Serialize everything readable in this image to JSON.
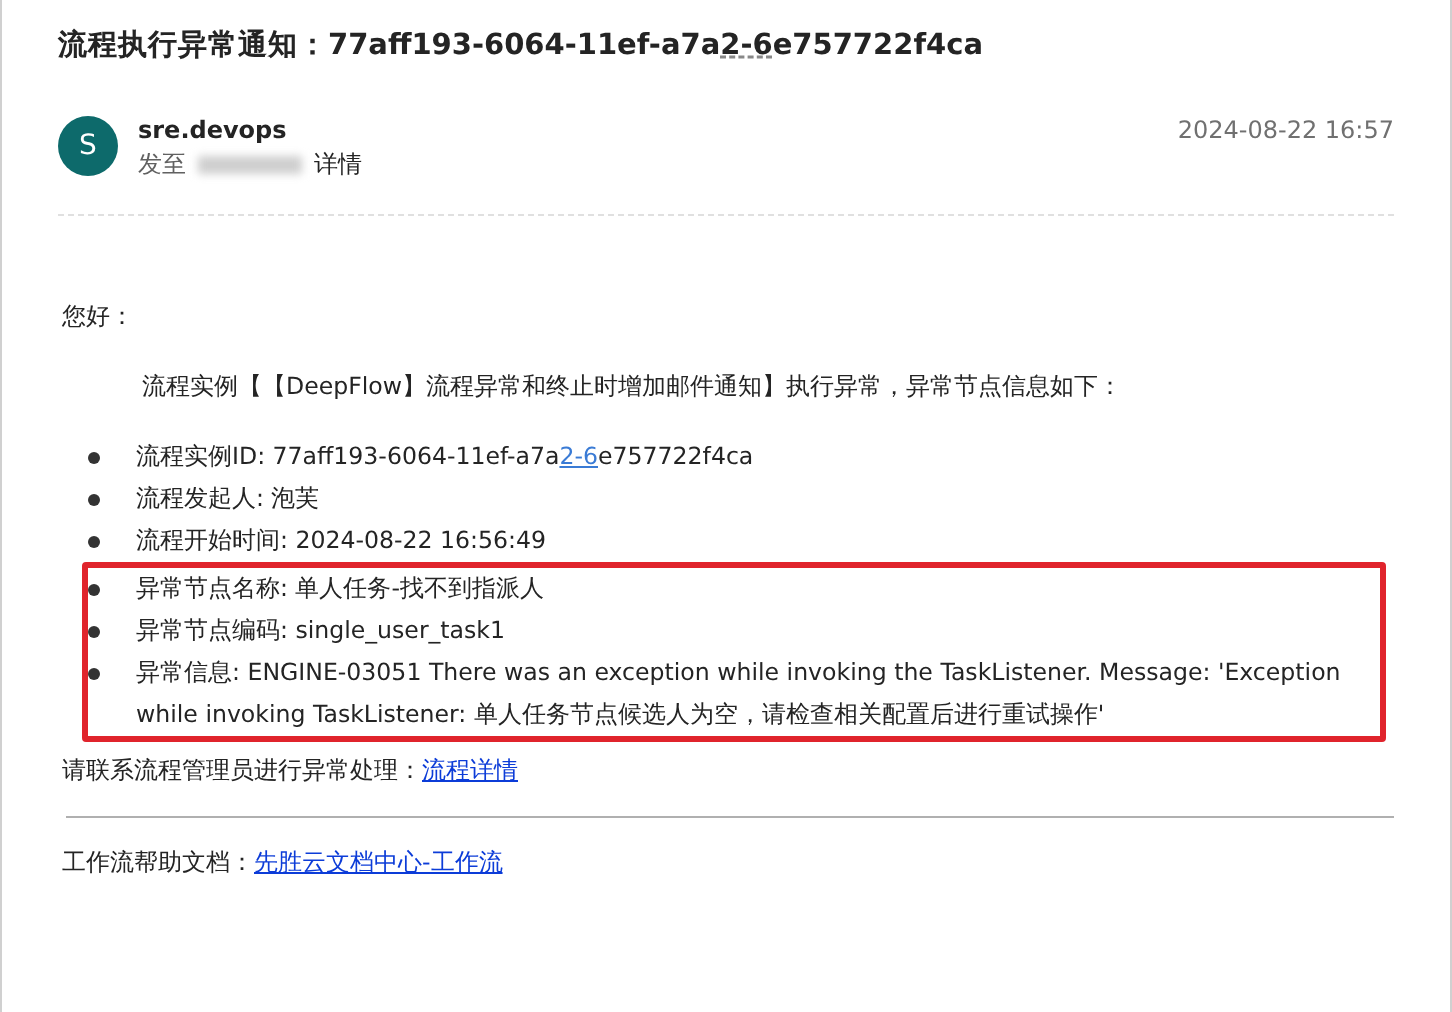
{
  "email": {
    "subject_parts": [
      {
        "text": "流程执行异常通知：77aff193-6064-11ef-a7a",
        "link": false
      },
      {
        "text": "2-6",
        "link": true
      },
      {
        "text": "e757722f4ca",
        "link": false
      }
    ],
    "sender": {
      "avatar_letter": "S",
      "name": "sre.devops",
      "to_label": "发至",
      "details_link": "详情",
      "date": "2024-08-22 16:57"
    },
    "greeting": "您好：",
    "intro": "流程实例【【DeepFlow】流程异常和终止时增加邮件通知】执行异常，异常节点信息如下：",
    "items": [
      {
        "label": "流程实例ID: ",
        "parts": [
          {
            "text": "77aff193-6064-11ef-a7a",
            "link": false
          },
          {
            "text": "2-6",
            "link": true
          },
          {
            "text": "e757722f4ca",
            "link": false
          }
        ],
        "highlighted": false
      },
      {
        "label": "流程发起人: ",
        "parts": [
          {
            "text": "泡芙",
            "link": false
          }
        ],
        "highlighted": false
      },
      {
        "label": "流程开始时间: ",
        "parts": [
          {
            "text": "2024-08-22 16:56:49",
            "link": false
          }
        ],
        "highlighted": false
      },
      {
        "label": "异常节点名称: ",
        "parts": [
          {
            "text": "单人任务-找不到指派人",
            "link": false
          }
        ],
        "highlighted": true
      },
      {
        "label": "异常节点编码: ",
        "parts": [
          {
            "text": "single_user_task1",
            "link": false
          }
        ],
        "highlighted": true
      },
      {
        "label": "异常信息: ",
        "parts": [
          {
            "text": "ENGINE-03051 There was an exception while invoking the TaskListener. Message: 'Exception while invoking TaskListener: 单人任务节点候选人为空，请检查相关配置后进行重试操作'",
            "link": false
          }
        ],
        "highlighted": true
      }
    ],
    "contact": {
      "text": "请联系流程管理员进行异常处理：",
      "link": "流程详情"
    },
    "help": {
      "text": "工作流帮助文档：",
      "link": "先胜云文档中心-工作流"
    }
  }
}
